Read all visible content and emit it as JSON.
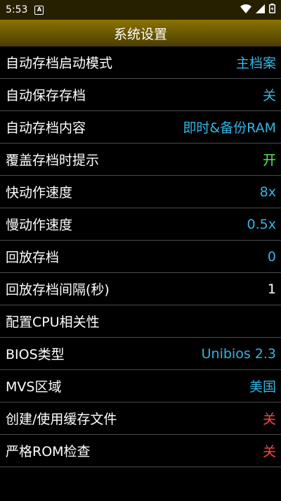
{
  "status_bar": {
    "time": "5:53",
    "notif_glyph": "A",
    "icons": [
      "wifi-icon",
      "signal-icon",
      "battery-icon"
    ]
  },
  "header": {
    "title": "系统设置"
  },
  "colors": {
    "value_blue": "#33b5e5",
    "value_green": "#55ee55",
    "value_red": "#ff4444",
    "value_white": "#ffffff"
  },
  "settings": [
    {
      "label": "自动存档启动模式",
      "value": "主档案",
      "color": "#33b5e5"
    },
    {
      "label": "自动保存存档",
      "value": "关",
      "color": "#33b5e5"
    },
    {
      "label": "自动存档内容",
      "value": "即时&备份RAM",
      "color": "#33b5e5"
    },
    {
      "label": "覆盖存档时提示",
      "value": "开",
      "color": "#55ee55"
    },
    {
      "label": "快动作速度",
      "value": "8x",
      "color": "#33b5e5"
    },
    {
      "label": "慢动作速度",
      "value": "0.5x",
      "color": "#33b5e5"
    },
    {
      "label": "回放存档",
      "value": "0",
      "color": "#33b5e5"
    },
    {
      "label": "回放存档间隔(秒)",
      "value": "1",
      "color": "#ffffff"
    },
    {
      "label": "配置CPU相关性",
      "value": "",
      "color": "#ffffff"
    },
    {
      "label": "BIOS类型",
      "value": "Unibios 2.3",
      "color": "#33b5e5"
    },
    {
      "label": "MVS区域",
      "value": "美国",
      "color": "#33b5e5"
    },
    {
      "label": "创建/使用缓存文件",
      "value": "关",
      "color": "#ff4444"
    },
    {
      "label": "严格ROM检查",
      "value": "关",
      "color": "#ff4444"
    }
  ]
}
